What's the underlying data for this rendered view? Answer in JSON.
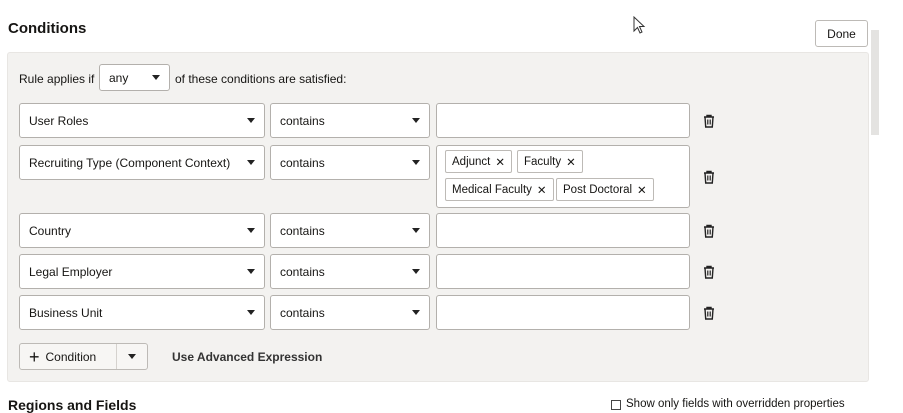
{
  "header": {
    "title": "Conditions",
    "done_label": "Done"
  },
  "rule": {
    "prefix": "Rule applies if",
    "match": "any",
    "suffix": "of these conditions are satisfied:"
  },
  "conditions": [
    {
      "field": "User Roles",
      "operator": "contains",
      "values": []
    },
    {
      "field": "Recruiting Type (Component Context)",
      "operator": "contains",
      "values": [
        "Adjunct",
        "Faculty",
        "Medical Faculty",
        "Post Doctoral"
      ]
    },
    {
      "field": "Country",
      "operator": "contains",
      "values": []
    },
    {
      "field": "Legal Employer",
      "operator": "contains",
      "values": []
    },
    {
      "field": "Business Unit",
      "operator": "contains",
      "values": []
    }
  ],
  "footer": {
    "add_condition": "Condition",
    "advanced": "Use Advanced Expression"
  },
  "next_section": {
    "title": "Regions and Fields",
    "checkbox_label": "Show only fields with overridden properties"
  }
}
